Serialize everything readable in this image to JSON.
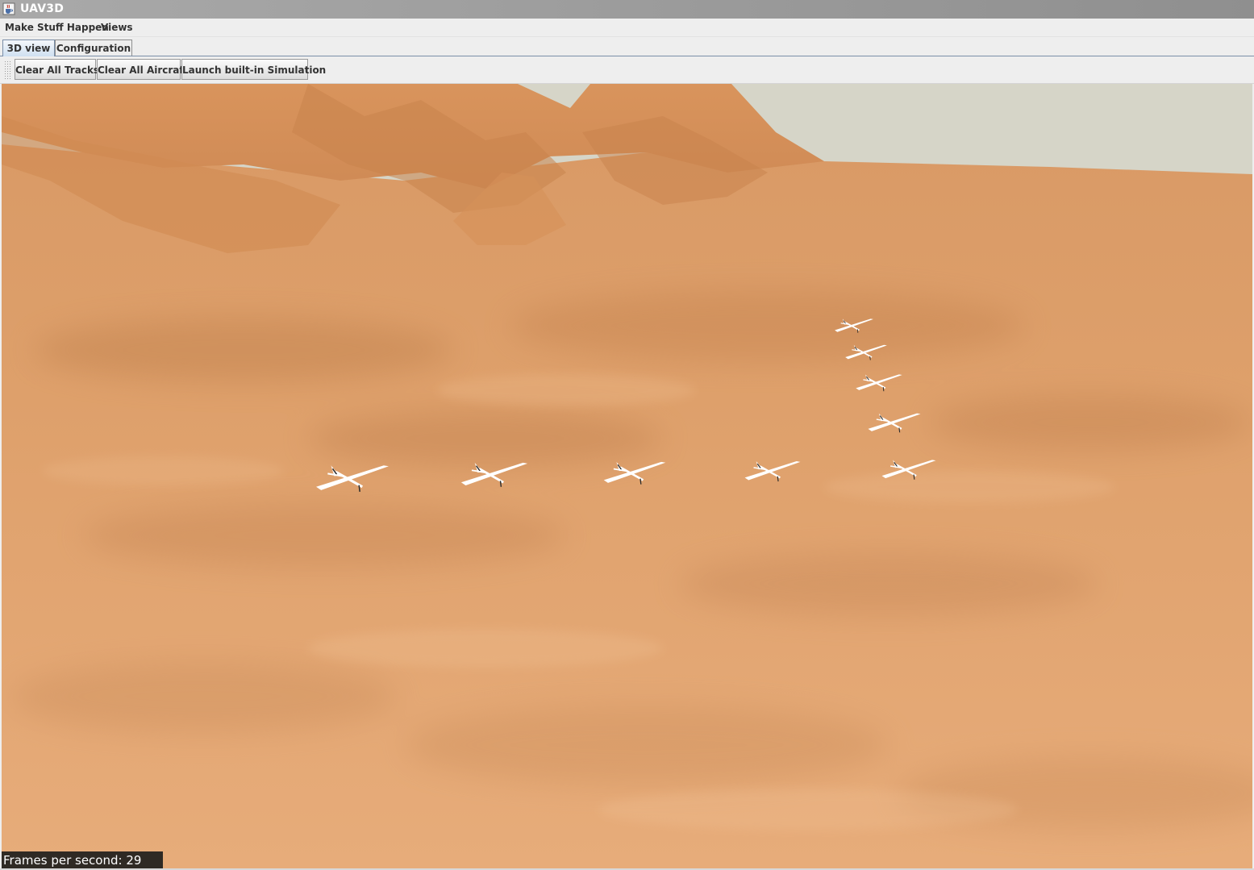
{
  "window": {
    "title": "UAV3D",
    "icon": "java-cup-icon"
  },
  "menu": {
    "items": [
      "Make Stuff Happen",
      "Views"
    ]
  },
  "tabs": [
    {
      "label": "3D view",
      "selected": true
    },
    {
      "label": "Configuration",
      "selected": false
    }
  ],
  "toolbar": {
    "buttons": [
      "Clear All Tracks",
      "Clear All Aircraft",
      "Launch built-in Simulation"
    ]
  },
  "viewport": {
    "aircraft_count": 9,
    "colors": {
      "sky": "#d6d5c8",
      "terrain": "#e4a66e",
      "aircraft": "#ffffff"
    },
    "aircraft_icon": "glider-aircraft-icon"
  },
  "status": {
    "fps_text": "Frames per second: 29"
  }
}
